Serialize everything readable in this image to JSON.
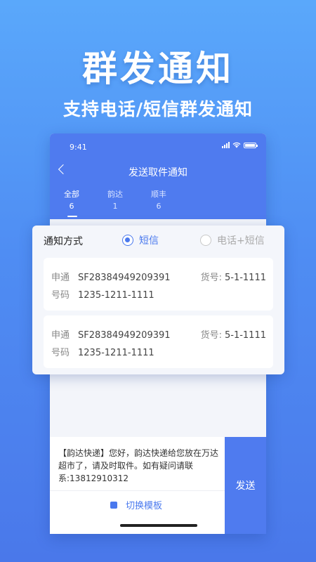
{
  "hero": {
    "title": "群发通知",
    "subtitle": "支持电话/短信群发通知"
  },
  "status_bar": {
    "time": "9:41"
  },
  "nav": {
    "title": "发送取件通知"
  },
  "tabs": [
    {
      "label": "全部",
      "count": "6",
      "active": true
    },
    {
      "label": "韵达",
      "count": "1",
      "active": false
    },
    {
      "label": "顺丰",
      "count": "6",
      "active": false
    }
  ],
  "notify": {
    "label": "通知方式",
    "options": [
      {
        "label": "短信",
        "selected": true
      },
      {
        "label": "电话+短信",
        "selected": false
      }
    ]
  },
  "packages": [
    {
      "courier": "申通",
      "tracking": "SF28384949209391",
      "slot_label": "货号:",
      "slot": "5-1-1111",
      "phone_label": "号码",
      "phone": "1235-1211-1111"
    },
    {
      "courier": "申通",
      "tracking": "SF28384949209391",
      "slot_label": "货号:",
      "slot": "5-1-1111",
      "phone_label": "号码",
      "phone": "1235-1211-1111"
    }
  ],
  "message": {
    "text": "【韵达快递】您好，韵达快递给您放在万达超市了，请及时取件。如有疑问请联系:13812910312",
    "switch_template": "切换模板",
    "send": "发送"
  },
  "colors": {
    "primary": "#4f7bef",
    "accent": "#4a79ee",
    "background_top": "#5aa8fb",
    "background_bottom": "#4a78ea"
  }
}
